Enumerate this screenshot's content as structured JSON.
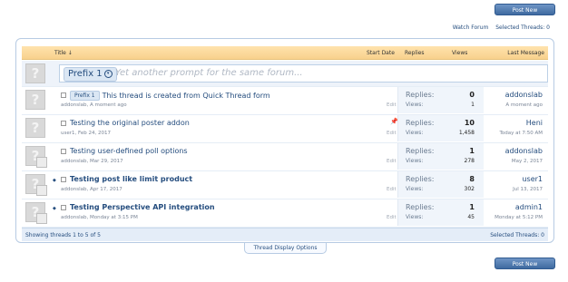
{
  "buttons": {
    "post_new_thread": "Post New Thread"
  },
  "toplinks": {
    "watch_forum": "Watch Forum",
    "selected_threads": "Selected Threads: 0"
  },
  "header": {
    "title": "Title ↓",
    "start_date": "Start Date",
    "replies": "Replies",
    "views": "Views",
    "last_message": "Last Message"
  },
  "quick": {
    "prefix": "Prefix 1",
    "placeholder": "Yet another prompt for the same forum..."
  },
  "threads": [
    {
      "prefix": "Prefix 1",
      "title": "This thread is created from Quick Thread form",
      "author": "addonslab",
      "date": "A moment ago",
      "edit": "Edit",
      "replies_label": "Replies:",
      "replies": "0",
      "views_label": "Views:",
      "views": "1",
      "last_user": "addonslab",
      "last_date": "A moment ago"
    },
    {
      "prefix": "",
      "title": "Testing the original poster addon",
      "author": "user1",
      "date": "Feb 24, 2017",
      "edit": "Edit",
      "replies_label": "Replies:",
      "replies": "10",
      "views_label": "Views:",
      "views": "1,458",
      "last_user": "Heni",
      "last_date": "Today at 7:50 AM"
    },
    {
      "prefix": "",
      "title": "Testing user-defined poll options",
      "author": "addonslab",
      "date": "Mar 29, 2017",
      "edit": "Edit",
      "replies_label": "Replies:",
      "replies": "1",
      "views_label": "Views:",
      "views": "278",
      "last_user": "addonslab",
      "last_date": "May 2, 2017"
    },
    {
      "prefix": "",
      "title": "Testing post like limit product",
      "author": "addonslab",
      "date": "Apr 17, 2017",
      "edit": "Edit",
      "replies_label": "Replies:",
      "replies": "8",
      "views_label": "Views:",
      "views": "302",
      "last_user": "user1",
      "last_date": "Jul 13, 2017"
    },
    {
      "prefix": "",
      "title": "Testing Perspective API integration",
      "author": "addonslab",
      "date": "Monday at 3:15 PM",
      "edit": "Edit",
      "replies_label": "Replies:",
      "replies": "1",
      "views_label": "Views:",
      "views": "45",
      "last_user": "admin1",
      "last_date": "Monday at 5:12 PM"
    }
  ],
  "footer": {
    "showing": "Showing threads 1 to 5 of 5",
    "selected": "Selected Threads: 0"
  },
  "thread_display_options": "Thread Display Options"
}
